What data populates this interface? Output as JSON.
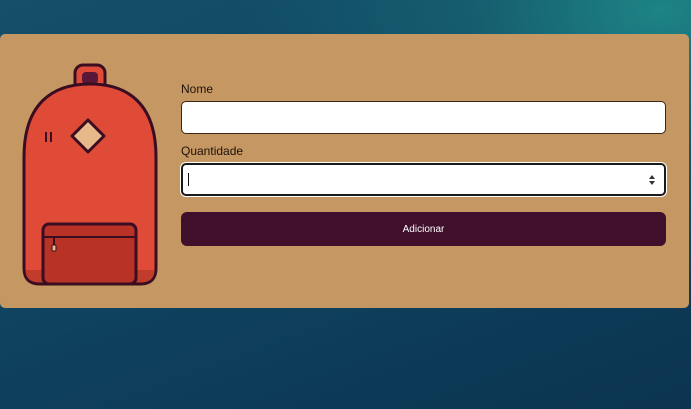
{
  "form": {
    "name_label": "Nome",
    "name_value": "",
    "quantity_label": "Quantidade",
    "quantity_value": "",
    "submit_label": "Adicionar"
  },
  "icons": {
    "illustration": "backpack-icon",
    "spinner": "spinner-arrows-icon"
  },
  "colors": {
    "card": "#c59763",
    "button": "#3f0f2c",
    "backpack_body": "#df4b37",
    "backpack_outline": "#3a0d22"
  }
}
